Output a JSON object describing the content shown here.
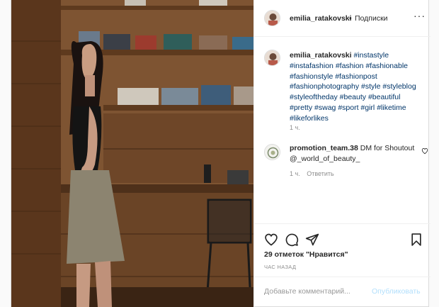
{
  "header": {
    "username": "emilia_ratakovski",
    "separator": "•",
    "follow_label": "Подписки",
    "more": "···"
  },
  "caption": {
    "username": "emilia_ratakovski",
    "hashtags": [
      "#instastyle",
      "#instafashion",
      "#fashion",
      "#fashionable",
      "#fashionstyle",
      "#fashionpost",
      "#fashionphotography",
      "#style",
      "#styleblog",
      "#styleoftheday",
      "#beauty",
      "#beautiful",
      "#pretty",
      "#swag",
      "#sport",
      "#girl",
      "#liketime",
      "#likeforlikes"
    ],
    "time": "1 ч."
  },
  "comment": {
    "username": "promotion_team.38",
    "text": "DM for Shoutout @_world_of_beauty_",
    "time": "1 ч.",
    "reply_label": "Ответить"
  },
  "actions": {
    "likes_text": "29 отметок \"Нравится\"",
    "time_ago": "ЧАС НАЗАД"
  },
  "add_comment": {
    "placeholder": "Добавьте комментарий...",
    "publish_label": "Опубликовать"
  },
  "colors": {
    "hashtag": "#003569",
    "publish_disabled": "#b2dffc",
    "meta_gray": "#8e8e8e",
    "border": "#dbdbdb"
  },
  "icons": {
    "like": "heart-icon",
    "comment": "comment-icon",
    "share": "paper-plane-icon",
    "save": "bookmark-icon"
  }
}
